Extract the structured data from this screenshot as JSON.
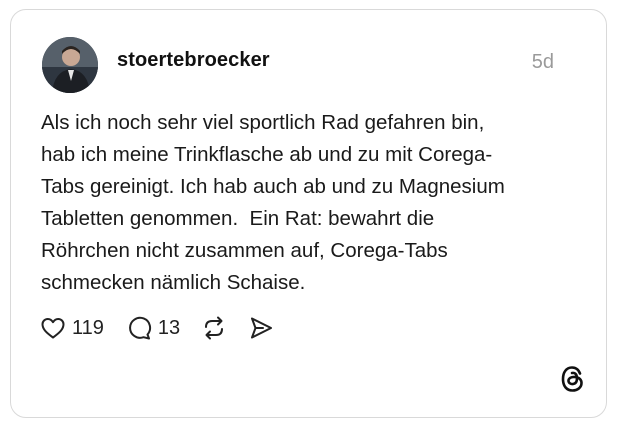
{
  "post": {
    "author": {
      "username": "stoertebroecker",
      "avatar_icon": "user-avatar-photo"
    },
    "timestamp": "5d",
    "lines": [
      "Als ich noch sehr viel sportlich Rad gefahren bin,",
      "hab ich meine Trinkflasche ab und zu mit Corega-",
      "Tabs gereinigt. Ich hab auch ab und zu Magnesium",
      "Tabletten genommen.  Ein Rat: bewahrt die",
      "Röhrchen nicht zusammen auf, Corega-Tabs",
      "schmecken nämlich Schaise."
    ],
    "actions": {
      "like_count": "119",
      "reply_count": "13",
      "icons": [
        "heart-icon",
        "comment-icon",
        "repost-icon",
        "share-icon"
      ]
    },
    "brand_icon": "threads-logo-icon"
  }
}
